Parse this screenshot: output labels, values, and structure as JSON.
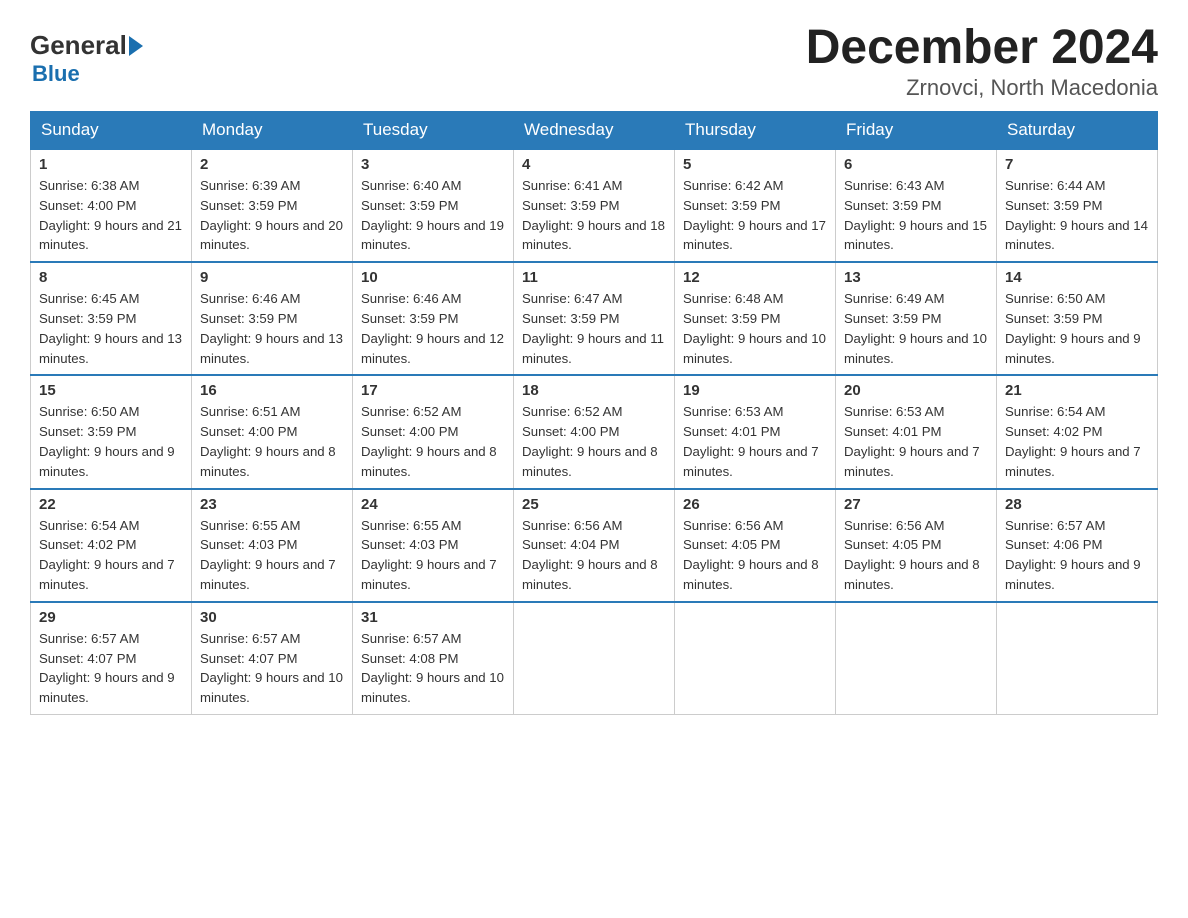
{
  "logo": {
    "general": "General",
    "blue": "Blue"
  },
  "title": {
    "month": "December 2024",
    "location": "Zrnovci, North Macedonia"
  },
  "header_days": [
    "Sunday",
    "Monday",
    "Tuesday",
    "Wednesday",
    "Thursday",
    "Friday",
    "Saturday"
  ],
  "weeks": [
    [
      {
        "day": "1",
        "sunrise": "6:38 AM",
        "sunset": "4:00 PM",
        "daylight": "9 hours and 21 minutes."
      },
      {
        "day": "2",
        "sunrise": "6:39 AM",
        "sunset": "3:59 PM",
        "daylight": "9 hours and 20 minutes."
      },
      {
        "day": "3",
        "sunrise": "6:40 AM",
        "sunset": "3:59 PM",
        "daylight": "9 hours and 19 minutes."
      },
      {
        "day": "4",
        "sunrise": "6:41 AM",
        "sunset": "3:59 PM",
        "daylight": "9 hours and 18 minutes."
      },
      {
        "day": "5",
        "sunrise": "6:42 AM",
        "sunset": "3:59 PM",
        "daylight": "9 hours and 17 minutes."
      },
      {
        "day": "6",
        "sunrise": "6:43 AM",
        "sunset": "3:59 PM",
        "daylight": "9 hours and 15 minutes."
      },
      {
        "day": "7",
        "sunrise": "6:44 AM",
        "sunset": "3:59 PM",
        "daylight": "9 hours and 14 minutes."
      }
    ],
    [
      {
        "day": "8",
        "sunrise": "6:45 AM",
        "sunset": "3:59 PM",
        "daylight": "9 hours and 13 minutes."
      },
      {
        "day": "9",
        "sunrise": "6:46 AM",
        "sunset": "3:59 PM",
        "daylight": "9 hours and 13 minutes."
      },
      {
        "day": "10",
        "sunrise": "6:46 AM",
        "sunset": "3:59 PM",
        "daylight": "9 hours and 12 minutes."
      },
      {
        "day": "11",
        "sunrise": "6:47 AM",
        "sunset": "3:59 PM",
        "daylight": "9 hours and 11 minutes."
      },
      {
        "day": "12",
        "sunrise": "6:48 AM",
        "sunset": "3:59 PM",
        "daylight": "9 hours and 10 minutes."
      },
      {
        "day": "13",
        "sunrise": "6:49 AM",
        "sunset": "3:59 PM",
        "daylight": "9 hours and 10 minutes."
      },
      {
        "day": "14",
        "sunrise": "6:50 AM",
        "sunset": "3:59 PM",
        "daylight": "9 hours and 9 minutes."
      }
    ],
    [
      {
        "day": "15",
        "sunrise": "6:50 AM",
        "sunset": "3:59 PM",
        "daylight": "9 hours and 9 minutes."
      },
      {
        "day": "16",
        "sunrise": "6:51 AM",
        "sunset": "4:00 PM",
        "daylight": "9 hours and 8 minutes."
      },
      {
        "day": "17",
        "sunrise": "6:52 AM",
        "sunset": "4:00 PM",
        "daylight": "9 hours and 8 minutes."
      },
      {
        "day": "18",
        "sunrise": "6:52 AM",
        "sunset": "4:00 PM",
        "daylight": "9 hours and 8 minutes."
      },
      {
        "day": "19",
        "sunrise": "6:53 AM",
        "sunset": "4:01 PM",
        "daylight": "9 hours and 7 minutes."
      },
      {
        "day": "20",
        "sunrise": "6:53 AM",
        "sunset": "4:01 PM",
        "daylight": "9 hours and 7 minutes."
      },
      {
        "day": "21",
        "sunrise": "6:54 AM",
        "sunset": "4:02 PM",
        "daylight": "9 hours and 7 minutes."
      }
    ],
    [
      {
        "day": "22",
        "sunrise": "6:54 AM",
        "sunset": "4:02 PM",
        "daylight": "9 hours and 7 minutes."
      },
      {
        "day": "23",
        "sunrise": "6:55 AM",
        "sunset": "4:03 PM",
        "daylight": "9 hours and 7 minutes."
      },
      {
        "day": "24",
        "sunrise": "6:55 AM",
        "sunset": "4:03 PM",
        "daylight": "9 hours and 7 minutes."
      },
      {
        "day": "25",
        "sunrise": "6:56 AM",
        "sunset": "4:04 PM",
        "daylight": "9 hours and 8 minutes."
      },
      {
        "day": "26",
        "sunrise": "6:56 AM",
        "sunset": "4:05 PM",
        "daylight": "9 hours and 8 minutes."
      },
      {
        "day": "27",
        "sunrise": "6:56 AM",
        "sunset": "4:05 PM",
        "daylight": "9 hours and 8 minutes."
      },
      {
        "day": "28",
        "sunrise": "6:57 AM",
        "sunset": "4:06 PM",
        "daylight": "9 hours and 9 minutes."
      }
    ],
    [
      {
        "day": "29",
        "sunrise": "6:57 AM",
        "sunset": "4:07 PM",
        "daylight": "9 hours and 9 minutes."
      },
      {
        "day": "30",
        "sunrise": "6:57 AM",
        "sunset": "4:07 PM",
        "daylight": "9 hours and 10 minutes."
      },
      {
        "day": "31",
        "sunrise": "6:57 AM",
        "sunset": "4:08 PM",
        "daylight": "9 hours and 10 minutes."
      },
      null,
      null,
      null,
      null
    ]
  ]
}
